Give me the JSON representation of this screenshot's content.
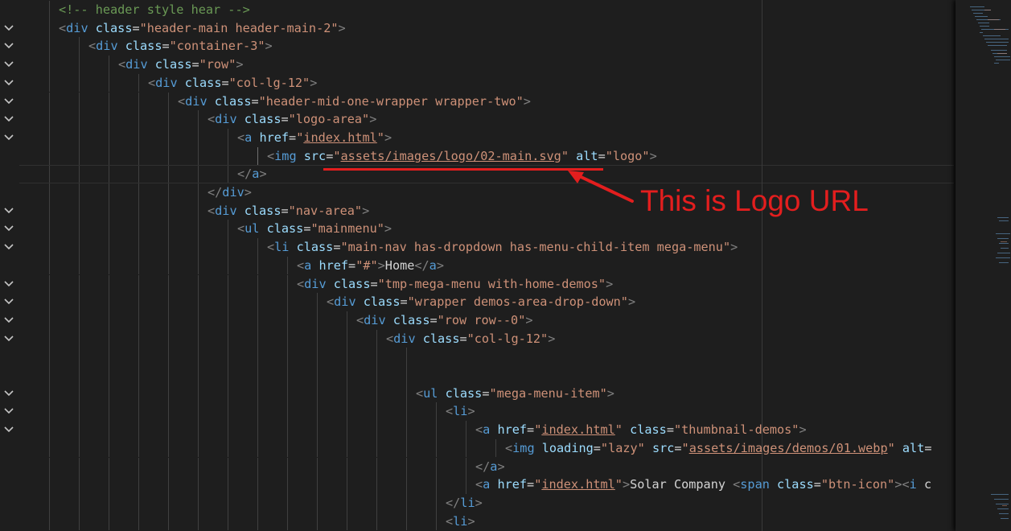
{
  "colors": {
    "background": "#1e1e1e",
    "tag_bracket": "#808080",
    "tag_name": "#569cd6",
    "attr_name": "#9cdcfe",
    "attr_value": "#ce9178",
    "comment": "#6a9955",
    "text": "#d4d4d4",
    "annotation": "#e31e1e"
  },
  "icons": {
    "fold": "chevron-down-icon"
  },
  "editor": {
    "lines": [
      {
        "indent": 2,
        "fold": false,
        "tokens": [
          {
            "t": "c",
            "v": "<!-- header style hear -->"
          }
        ]
      },
      {
        "indent": 2,
        "fold": true,
        "tokens": [
          {
            "t": "p",
            "v": "<"
          },
          {
            "t": "g",
            "v": "div"
          },
          {
            "t": "s",
            "v": " "
          },
          {
            "t": "a",
            "v": "class"
          },
          {
            "t": "s",
            "v": "="
          },
          {
            "t": "q",
            "v": "\"header-main header-main-2\""
          },
          {
            "t": "p",
            "v": ">"
          }
        ]
      },
      {
        "indent": 3,
        "fold": true,
        "tokens": [
          {
            "t": "p",
            "v": "<"
          },
          {
            "t": "g",
            "v": "div"
          },
          {
            "t": "s",
            "v": " "
          },
          {
            "t": "a",
            "v": "class"
          },
          {
            "t": "s",
            "v": "="
          },
          {
            "t": "q",
            "v": "\"container-3\""
          },
          {
            "t": "p",
            "v": ">"
          }
        ]
      },
      {
        "indent": 4,
        "fold": true,
        "tokens": [
          {
            "t": "p",
            "v": "<"
          },
          {
            "t": "g",
            "v": "div"
          },
          {
            "t": "s",
            "v": " "
          },
          {
            "t": "a",
            "v": "class"
          },
          {
            "t": "s",
            "v": "="
          },
          {
            "t": "q",
            "v": "\"row\""
          },
          {
            "t": "p",
            "v": ">"
          }
        ]
      },
      {
        "indent": 5,
        "fold": true,
        "tokens": [
          {
            "t": "p",
            "v": "<"
          },
          {
            "t": "g",
            "v": "div"
          },
          {
            "t": "s",
            "v": " "
          },
          {
            "t": "a",
            "v": "class"
          },
          {
            "t": "s",
            "v": "="
          },
          {
            "t": "q",
            "v": "\"col-lg-12\""
          },
          {
            "t": "p",
            "v": ">"
          }
        ]
      },
      {
        "indent": 6,
        "fold": true,
        "tokens": [
          {
            "t": "p",
            "v": "<"
          },
          {
            "t": "g",
            "v": "div"
          },
          {
            "t": "s",
            "v": " "
          },
          {
            "t": "a",
            "v": "class"
          },
          {
            "t": "s",
            "v": "="
          },
          {
            "t": "q",
            "v": "\"header-mid-one-wrapper wrapper-two\""
          },
          {
            "t": "p",
            "v": ">"
          }
        ]
      },
      {
        "indent": 7,
        "fold": true,
        "tokens": [
          {
            "t": "p",
            "v": "<"
          },
          {
            "t": "g",
            "v": "div"
          },
          {
            "t": "s",
            "v": " "
          },
          {
            "t": "a",
            "v": "class"
          },
          {
            "t": "s",
            "v": "="
          },
          {
            "t": "q",
            "v": "\"logo-area\""
          },
          {
            "t": "p",
            "v": ">"
          }
        ]
      },
      {
        "indent": 8,
        "fold": true,
        "tokens": [
          {
            "t": "p",
            "v": "<"
          },
          {
            "t": "g",
            "v": "a"
          },
          {
            "t": "s",
            "v": " "
          },
          {
            "t": "a",
            "v": "href"
          },
          {
            "t": "s",
            "v": "="
          },
          {
            "t": "q",
            "v": "\""
          },
          {
            "t": "u",
            "v": "index.html"
          },
          {
            "t": "q",
            "v": "\""
          },
          {
            "t": "p",
            "v": ">"
          }
        ]
      },
      {
        "indent": 9,
        "fold": false,
        "tokens": [
          {
            "t": "p",
            "v": "<"
          },
          {
            "t": "g",
            "v": "img"
          },
          {
            "t": "s",
            "v": " "
          },
          {
            "t": "a",
            "v": "src"
          },
          {
            "t": "s",
            "v": "="
          },
          {
            "t": "q",
            "v": "\""
          },
          {
            "t": "u",
            "v": "assets/images/logo/02-main.svg"
          },
          {
            "t": "q",
            "v": "\""
          },
          {
            "t": "s",
            "v": " "
          },
          {
            "t": "a",
            "v": "alt"
          },
          {
            "t": "s",
            "v": "="
          },
          {
            "t": "q",
            "v": "\"logo\""
          },
          {
            "t": "p",
            "v": ">"
          }
        ]
      },
      {
        "indent": 8,
        "fold": false,
        "tokens": [
          {
            "t": "p",
            "v": "</"
          },
          {
            "t": "g",
            "v": "a"
          },
          {
            "t": "p",
            "v": ">"
          }
        ]
      },
      {
        "indent": 7,
        "fold": false,
        "tokens": [
          {
            "t": "p",
            "v": "</"
          },
          {
            "t": "g",
            "v": "div"
          },
          {
            "t": "p",
            "v": ">"
          }
        ]
      },
      {
        "indent": 7,
        "fold": true,
        "tokens": [
          {
            "t": "p",
            "v": "<"
          },
          {
            "t": "g",
            "v": "div"
          },
          {
            "t": "s",
            "v": " "
          },
          {
            "t": "a",
            "v": "class"
          },
          {
            "t": "s",
            "v": "="
          },
          {
            "t": "q",
            "v": "\"nav-area\""
          },
          {
            "t": "p",
            "v": ">"
          }
        ]
      },
      {
        "indent": 8,
        "fold": true,
        "tokens": [
          {
            "t": "p",
            "v": "<"
          },
          {
            "t": "g",
            "v": "ul"
          },
          {
            "t": "s",
            "v": " "
          },
          {
            "t": "a",
            "v": "class"
          },
          {
            "t": "s",
            "v": "="
          },
          {
            "t": "q",
            "v": "\"mainmenu\""
          },
          {
            "t": "p",
            "v": ">"
          }
        ]
      },
      {
        "indent": 9,
        "fold": true,
        "tokens": [
          {
            "t": "p",
            "v": "<"
          },
          {
            "t": "g",
            "v": "li"
          },
          {
            "t": "s",
            "v": " "
          },
          {
            "t": "a",
            "v": "class"
          },
          {
            "t": "s",
            "v": "="
          },
          {
            "t": "q",
            "v": "\"main-nav has-dropdown has-menu-child-item mega-menu\""
          },
          {
            "t": "p",
            "v": ">"
          }
        ]
      },
      {
        "indent": 10,
        "fold": false,
        "tokens": [
          {
            "t": "p",
            "v": "<"
          },
          {
            "t": "g",
            "v": "a"
          },
          {
            "t": "s",
            "v": " "
          },
          {
            "t": "a",
            "v": "href"
          },
          {
            "t": "s",
            "v": "="
          },
          {
            "t": "q",
            "v": "\"#\""
          },
          {
            "t": "p",
            "v": ">"
          },
          {
            "t": "s",
            "v": "Home"
          },
          {
            "t": "p",
            "v": "</"
          },
          {
            "t": "g",
            "v": "a"
          },
          {
            "t": "p",
            "v": ">"
          }
        ]
      },
      {
        "indent": 10,
        "fold": true,
        "tokens": [
          {
            "t": "p",
            "v": "<"
          },
          {
            "t": "g",
            "v": "div"
          },
          {
            "t": "s",
            "v": " "
          },
          {
            "t": "a",
            "v": "class"
          },
          {
            "t": "s",
            "v": "="
          },
          {
            "t": "q",
            "v": "\"tmp-mega-menu with-home-demos\""
          },
          {
            "t": "p",
            "v": ">"
          }
        ]
      },
      {
        "indent": 11,
        "fold": true,
        "tokens": [
          {
            "t": "p",
            "v": "<"
          },
          {
            "t": "g",
            "v": "div"
          },
          {
            "t": "s",
            "v": " "
          },
          {
            "t": "a",
            "v": "class"
          },
          {
            "t": "s",
            "v": "="
          },
          {
            "t": "q",
            "v": "\"wrapper demos-area-drop-down\""
          },
          {
            "t": "p",
            "v": ">"
          }
        ]
      },
      {
        "indent": 12,
        "fold": true,
        "tokens": [
          {
            "t": "p",
            "v": "<"
          },
          {
            "t": "g",
            "v": "div"
          },
          {
            "t": "s",
            "v": " "
          },
          {
            "t": "a",
            "v": "class"
          },
          {
            "t": "s",
            "v": "="
          },
          {
            "t": "q",
            "v": "\"row row--0\""
          },
          {
            "t": "p",
            "v": ">"
          }
        ]
      },
      {
        "indent": 13,
        "fold": true,
        "tokens": [
          {
            "t": "p",
            "v": "<"
          },
          {
            "t": "g",
            "v": "div"
          },
          {
            "t": "s",
            "v": " "
          },
          {
            "t": "a",
            "v": "class"
          },
          {
            "t": "s",
            "v": "="
          },
          {
            "t": "q",
            "v": "\"col-lg-12\""
          },
          {
            "t": "p",
            "v": ">"
          }
        ]
      },
      {
        "indent": 14,
        "fold": false,
        "tokens": []
      },
      {
        "indent": 14,
        "fold": false,
        "tokens": []
      },
      {
        "indent": 14,
        "fold": true,
        "tokens": [
          {
            "t": "p",
            "v": "<"
          },
          {
            "t": "g",
            "v": "ul"
          },
          {
            "t": "s",
            "v": " "
          },
          {
            "t": "a",
            "v": "class"
          },
          {
            "t": "s",
            "v": "="
          },
          {
            "t": "q",
            "v": "\"mega-menu-item\""
          },
          {
            "t": "p",
            "v": ">"
          }
        ]
      },
      {
        "indent": 15,
        "fold": true,
        "tokens": [
          {
            "t": "p",
            "v": "<"
          },
          {
            "t": "g",
            "v": "li"
          },
          {
            "t": "p",
            "v": ">"
          }
        ]
      },
      {
        "indent": 16,
        "fold": true,
        "tokens": [
          {
            "t": "p",
            "v": "<"
          },
          {
            "t": "g",
            "v": "a"
          },
          {
            "t": "s",
            "v": " "
          },
          {
            "t": "a",
            "v": "href"
          },
          {
            "t": "s",
            "v": "="
          },
          {
            "t": "q",
            "v": "\""
          },
          {
            "t": "u",
            "v": "index.html"
          },
          {
            "t": "q",
            "v": "\""
          },
          {
            "t": "s",
            "v": " "
          },
          {
            "t": "a",
            "v": "class"
          },
          {
            "t": "s",
            "v": "="
          },
          {
            "t": "q",
            "v": "\"thumbnail-demos\""
          },
          {
            "t": "p",
            "v": ">"
          }
        ]
      },
      {
        "indent": 17,
        "fold": false,
        "tokens": [
          {
            "t": "p",
            "v": "<"
          },
          {
            "t": "g",
            "v": "img"
          },
          {
            "t": "s",
            "v": " "
          },
          {
            "t": "a",
            "v": "loading"
          },
          {
            "t": "s",
            "v": "="
          },
          {
            "t": "q",
            "v": "\"lazy\""
          },
          {
            "t": "s",
            "v": " "
          },
          {
            "t": "a",
            "v": "src"
          },
          {
            "t": "s",
            "v": "="
          },
          {
            "t": "q",
            "v": "\""
          },
          {
            "t": "u",
            "v": "assets/images/demos/01.webp"
          },
          {
            "t": "q",
            "v": "\""
          },
          {
            "t": "s",
            "v": " "
          },
          {
            "t": "a",
            "v": "alt"
          },
          {
            "t": "s",
            "v": "="
          }
        ]
      },
      {
        "indent": 16,
        "fold": false,
        "tokens": [
          {
            "t": "p",
            "v": "</"
          },
          {
            "t": "g",
            "v": "a"
          },
          {
            "t": "p",
            "v": ">"
          }
        ]
      },
      {
        "indent": 16,
        "fold": false,
        "tokens": [
          {
            "t": "p",
            "v": "<"
          },
          {
            "t": "g",
            "v": "a"
          },
          {
            "t": "s",
            "v": " "
          },
          {
            "t": "a",
            "v": "href"
          },
          {
            "t": "s",
            "v": "="
          },
          {
            "t": "q",
            "v": "\""
          },
          {
            "t": "u",
            "v": "index.html"
          },
          {
            "t": "q",
            "v": "\""
          },
          {
            "t": "p",
            "v": ">"
          },
          {
            "t": "s",
            "v": "Solar Company "
          },
          {
            "t": "p",
            "v": "<"
          },
          {
            "t": "g",
            "v": "span"
          },
          {
            "t": "s",
            "v": " "
          },
          {
            "t": "a",
            "v": "class"
          },
          {
            "t": "s",
            "v": "="
          },
          {
            "t": "q",
            "v": "\"btn-icon\""
          },
          {
            "t": "p",
            "v": ">"
          },
          {
            "t": "p",
            "v": "<"
          },
          {
            "t": "g",
            "v": "i"
          },
          {
            "t": "s",
            "v": " c"
          }
        ]
      },
      {
        "indent": 15,
        "fold": false,
        "tokens": [
          {
            "t": "p",
            "v": "</"
          },
          {
            "t": "g",
            "v": "li"
          },
          {
            "t": "p",
            "v": ">"
          }
        ]
      },
      {
        "indent": 15,
        "fold": false,
        "tokens": [
          {
            "t": "p",
            "v": "<"
          },
          {
            "t": "g",
            "v": "li"
          },
          {
            "t": "p",
            "v": ">"
          }
        ]
      }
    ]
  },
  "annotation": {
    "label": "This is Logo URL"
  }
}
